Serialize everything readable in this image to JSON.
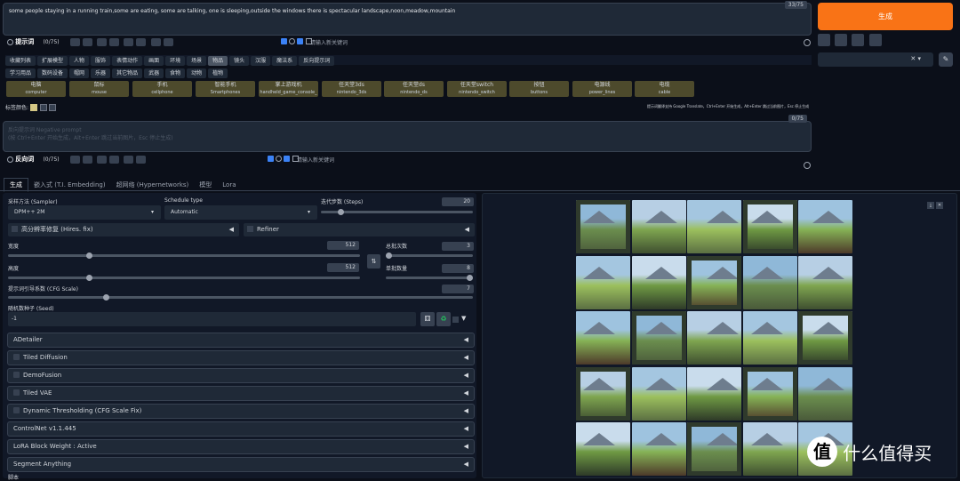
{
  "prompt": {
    "text": "some people staying in a running train,some are eating, some are talking, one is sleeping,outside the windows there is spectacular landscape,noon,meadow,mountain",
    "counter": "33/75",
    "label": "提示词",
    "token_count": "(0/75)",
    "keyword_placeholder": "请输入新关键词"
  },
  "generate_button": "生成",
  "categories": [
    "收藏列表",
    "扩展模型",
    "人物",
    "服饰",
    "表情动作",
    "画面",
    "环境",
    "场景",
    "物品",
    "镜头",
    "汉服",
    "魔法系",
    "反向提示词"
  ],
  "subcategories": [
    "学习用品",
    "数码设备",
    "帽网",
    "乐器",
    "其它物品",
    "武器",
    "食物",
    "动物",
    "植物"
  ],
  "tags": [
    {
      "zh": "电脑",
      "en": "computer"
    },
    {
      "zh": "鼠标",
      "en": "mouse"
    },
    {
      "zh": "手机",
      "en": "cellphone"
    },
    {
      "zh": "智能手机",
      "en": "Smartphones"
    },
    {
      "zh": "掌上游戏机",
      "en": "handheld_game_console_"
    },
    {
      "zh": "任天堂3ds",
      "en": "nintendo_3ds"
    },
    {
      "zh": "任天堂ds",
      "en": "nintendo_ds"
    },
    {
      "zh": "任天堂switch",
      "en": "nintendo_switch"
    },
    {
      "zh": "按钮",
      "en": "buttons"
    },
    {
      "zh": "电源线",
      "en": "power_lines"
    },
    {
      "zh": "电缆",
      "en": "cable"
    }
  ],
  "tag_color_label": "标签颜色:",
  "hint_text": "提示词翻译支持 Google Translate，Ctrl+Enter 开始生成，Alt+Enter 跳过当前图片，Esc 停止生成",
  "negative": {
    "placeholder": "反向提示词 Negative prompt",
    "hint": "(按 Ctrl+Enter 开始生成，Alt+Enter 跳过当前图片，Esc 停止生成)",
    "counter": "0/75",
    "label": "反向词",
    "token_count": "(0/75)",
    "keyword_placeholder": "请输入新关键词"
  },
  "tabs": [
    "生成",
    "嵌入式 (T.I. Embedding)",
    "超网络 (Hypernetworks)",
    "模型",
    "Lora"
  ],
  "sampler": {
    "label": "采样方法 (Sampler)",
    "value": "DPM++ 2M"
  },
  "schedule": {
    "label": "Schedule type",
    "value": "Automatic"
  },
  "steps": {
    "label": "迭代步数 (Steps)",
    "value": "20",
    "fraction": 0.13
  },
  "hires": "高分辨率修复 (Hires. fix)",
  "refiner": "Refiner",
  "width": {
    "label": "宽度",
    "value": "512",
    "fraction": 0.23
  },
  "height": {
    "label": "高度",
    "value": "512",
    "fraction": 0.23
  },
  "batch_count": {
    "label": "总批次数",
    "value": "3",
    "fraction": 0.02
  },
  "batch_size": {
    "label": "单批数量",
    "value": "8",
    "fraction": 1.0
  },
  "cfg": {
    "label": "提示词引导系数 (CFG Scale)",
    "value": "7",
    "fraction": 0.21
  },
  "seed": {
    "label": "随机数种子 (Seed)",
    "value": "-1"
  },
  "accordions": [
    {
      "label": "ADetailer",
      "checkbox": false
    },
    {
      "label": "Tiled Diffusion",
      "checkbox": true
    },
    {
      "label": "DemoFusion",
      "checkbox": true
    },
    {
      "label": "Tiled VAE",
      "checkbox": true
    },
    {
      "label": "Dynamic Thresholding (CFG Scale Fix)",
      "checkbox": true
    },
    {
      "label": "ControlNet v1.1.445",
      "checkbox": false
    },
    {
      "label": "LoRA Block Weight : Active",
      "checkbox": false
    },
    {
      "label": "Segment Anything",
      "checkbox": false
    }
  ],
  "bottom_label": "脚本",
  "watermark": "什么值得买",
  "colors": {
    "generate": "#f97316",
    "bg": "#0b0f19",
    "panel": "#1f2937",
    "tag": "#4d4a2c"
  }
}
